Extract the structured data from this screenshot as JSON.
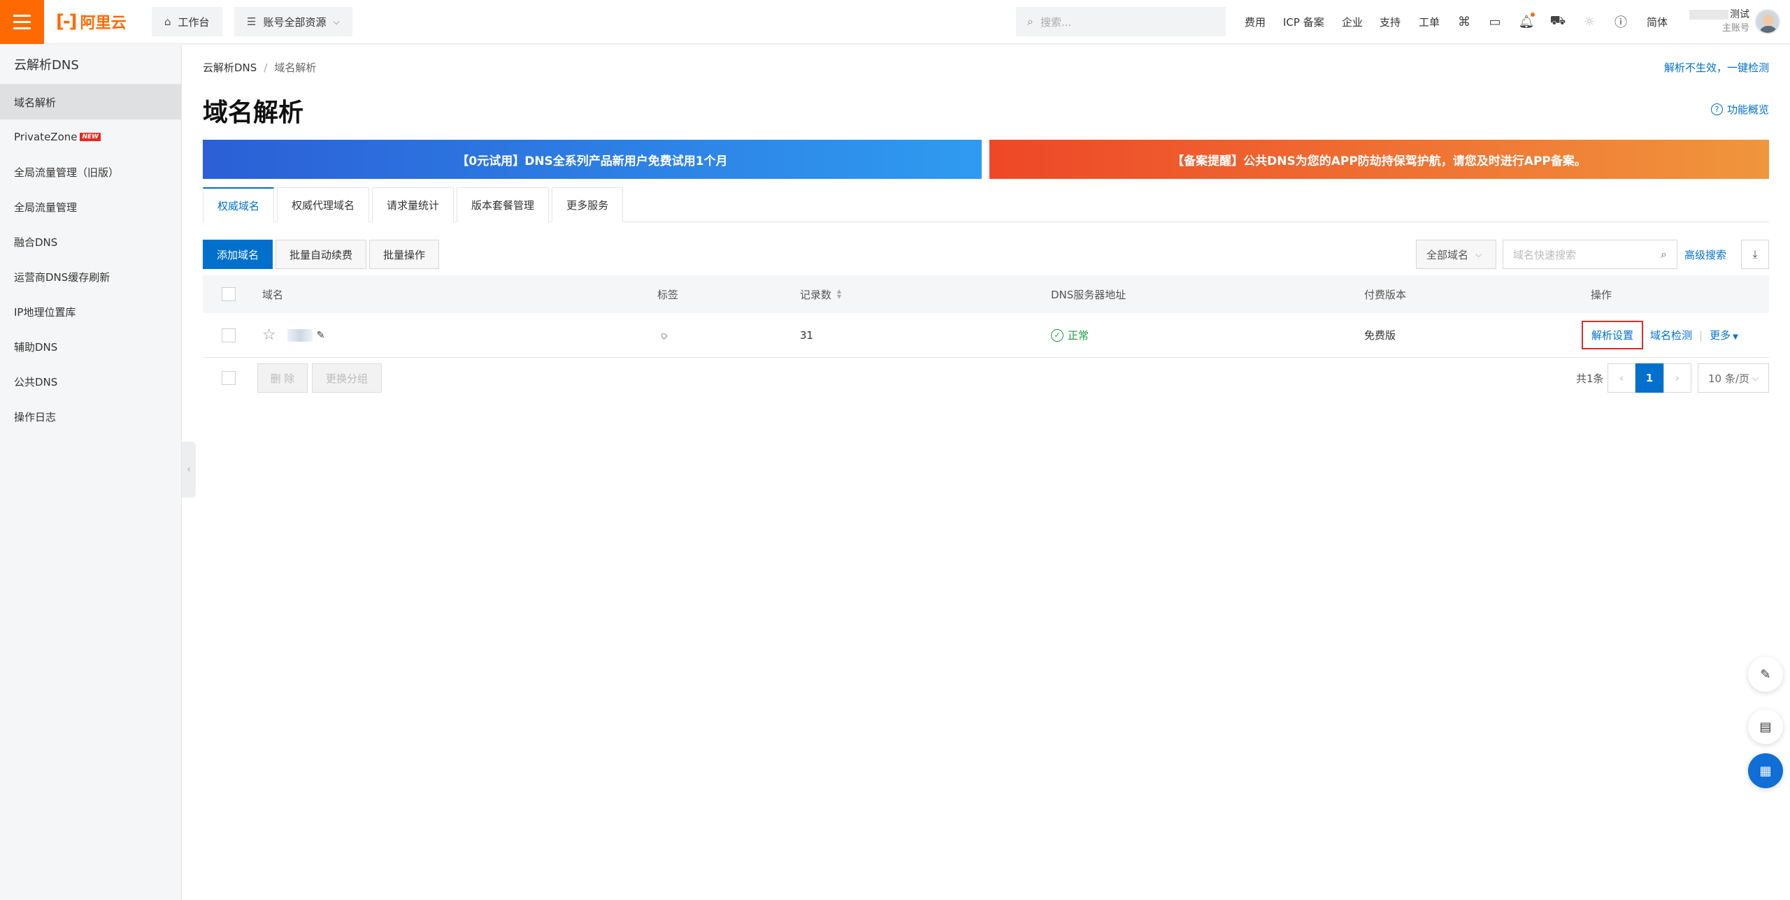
{
  "header": {
    "logo_text": "阿里云",
    "workbench": "工作台",
    "resource_scope": "账号全部资源",
    "search_placeholder": "搜索...",
    "nav": [
      "费用",
      "ICP 备案",
      "企业",
      "支持",
      "工单"
    ],
    "lang": "简体",
    "user_name": "测试",
    "user_role": "主账号"
  },
  "sidebar": {
    "title": "云解析DNS",
    "items": [
      {
        "label": "域名解析",
        "active": true
      },
      {
        "label": "PrivateZone",
        "badge": "NEW"
      },
      {
        "label": "全局流量管理（旧版）"
      },
      {
        "label": "全局流量管理"
      },
      {
        "label": "融合DNS"
      },
      {
        "label": "运营商DNS缓存刷新"
      },
      {
        "label": "IP地理位置库"
      },
      {
        "label": "辅助DNS"
      },
      {
        "label": "公共DNS"
      },
      {
        "label": "操作日志"
      }
    ]
  },
  "breadcrumb": [
    "云解析DNS",
    "域名解析"
  ],
  "top_link": "解析不生效，一键检测",
  "page_title": "域名解析",
  "overview_link": "功能概览",
  "banners": [
    "【0元试用】DNS全系列产品新用户免费试用1个月",
    "【备案提醒】公共DNS为您的APP防劫持保驾护航，请您及时进行APP备案。"
  ],
  "tabs": [
    "权威域名",
    "权威代理域名",
    "请求量统计",
    "版本套餐管理",
    "更多服务"
  ],
  "actions": {
    "add": "添加域名",
    "batch_renew": "批量自动续费",
    "batch_ops": "批量操作",
    "domain_filter": "全部域名",
    "quick_search_placeholder": "域名快速搜索",
    "advanced_search": "高级搜索"
  },
  "table": {
    "headers": [
      "域名",
      "标签",
      "记录数",
      "DNS服务器地址",
      "付费版本",
      "操作"
    ],
    "rows": [
      {
        "records": "31",
        "dns_status": "正常",
        "edition": "免费版",
        "ops": [
          "解析设置",
          "域名检测",
          "更多"
        ]
      }
    ]
  },
  "footer": {
    "delete": "删 除",
    "change_group": "更换分组",
    "total": "共1条",
    "current_page": "1",
    "page_size": "10 条/页"
  },
  "colors": {
    "brand": "#ff6a00",
    "primary": "#0070cc",
    "success": "#1d9b3f",
    "highlight": "#e12b27"
  }
}
